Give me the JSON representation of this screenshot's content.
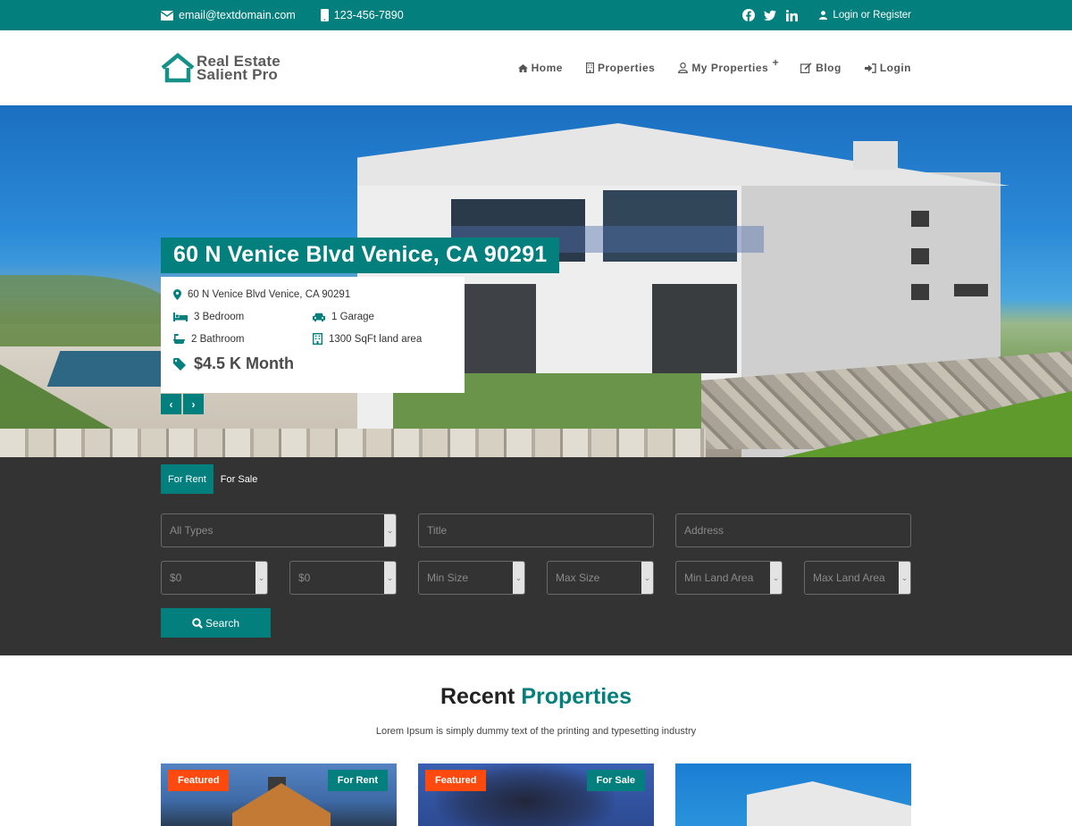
{
  "topbar": {
    "email": "email@textdomain.com",
    "phone": "123-456-7890",
    "social": [
      "facebook-icon",
      "twitter-icon",
      "linkedin-icon"
    ],
    "login_register": "Login or Register"
  },
  "header": {
    "logo_line1": "Real Estate",
    "logo_line2": "Salient Pro",
    "nav": [
      {
        "label": "Home",
        "icon": "home-icon"
      },
      {
        "label": "Properties",
        "icon": "building-icon"
      },
      {
        "label": "My Properties",
        "icon": "user-icon",
        "submenu_indicator": "+"
      },
      {
        "label": "Blog",
        "icon": "edit-icon"
      },
      {
        "label": "Login",
        "icon": "sign-in-icon"
      }
    ]
  },
  "hero": {
    "title": "60 N Venice Blvd Venice, CA 90291",
    "address": "60 N Venice Blvd Venice, CA 90291",
    "bedrooms": "3 Bedroom",
    "garage": "1 Garage",
    "bathrooms": "2 Bathroom",
    "land_area": "1300 SqFt land area",
    "price": "$4.5 K Month",
    "prev": "‹",
    "next": "›"
  },
  "search": {
    "tabs": [
      {
        "label": "For Rent",
        "active": true
      },
      {
        "label": "For Sale",
        "active": false
      }
    ],
    "type_select": "All Types",
    "title_placeholder": "Title",
    "address_placeholder": "Address",
    "min_price": "$0",
    "max_price": "$0",
    "min_size": "Min Size",
    "max_size": "Max Size",
    "min_land": "Min Land Area",
    "max_land": "Max Land Area",
    "button": "Search"
  },
  "recent": {
    "title_main": "Recent",
    "title_accent": "Properties",
    "subtitle": "Lorem Ipsum is simply dummy text of the printing and typesetting industry",
    "cards": [
      {
        "featured": "Featured",
        "type": "For Rent"
      },
      {
        "featured": "Featured",
        "type": "For Sale"
      },
      {}
    ]
  },
  "colors": {
    "primary": "#037f7d",
    "featured": "#ff4a0f",
    "search_bg": "#333333"
  }
}
